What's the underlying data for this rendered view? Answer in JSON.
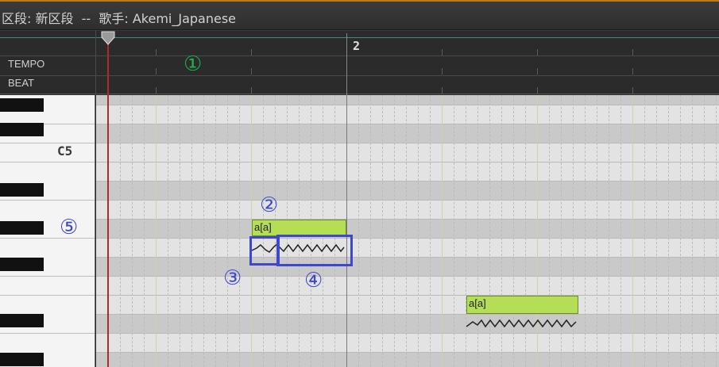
{
  "window": {
    "title": "区段: 新区段  --  歌手: Akemi_Japanese"
  },
  "ruler": {
    "measure_number": "2",
    "rows": [
      "TEMPO",
      "BEAT"
    ]
  },
  "piano": {
    "octave_label": "C5"
  },
  "notes": [
    {
      "lyric": "a[a]"
    },
    {
      "lyric": "a[a]"
    }
  ],
  "annotations": {
    "c1": "①",
    "c2": "②",
    "c3": "③",
    "c4": "④",
    "c5": "⑤"
  },
  "colors": {
    "note_fill": "#b3de55",
    "playhead": "#b02a2a",
    "annotation_blue": "#3f48cc",
    "annotation_green": "#22b14c",
    "title_accent": "#c07a1e"
  }
}
